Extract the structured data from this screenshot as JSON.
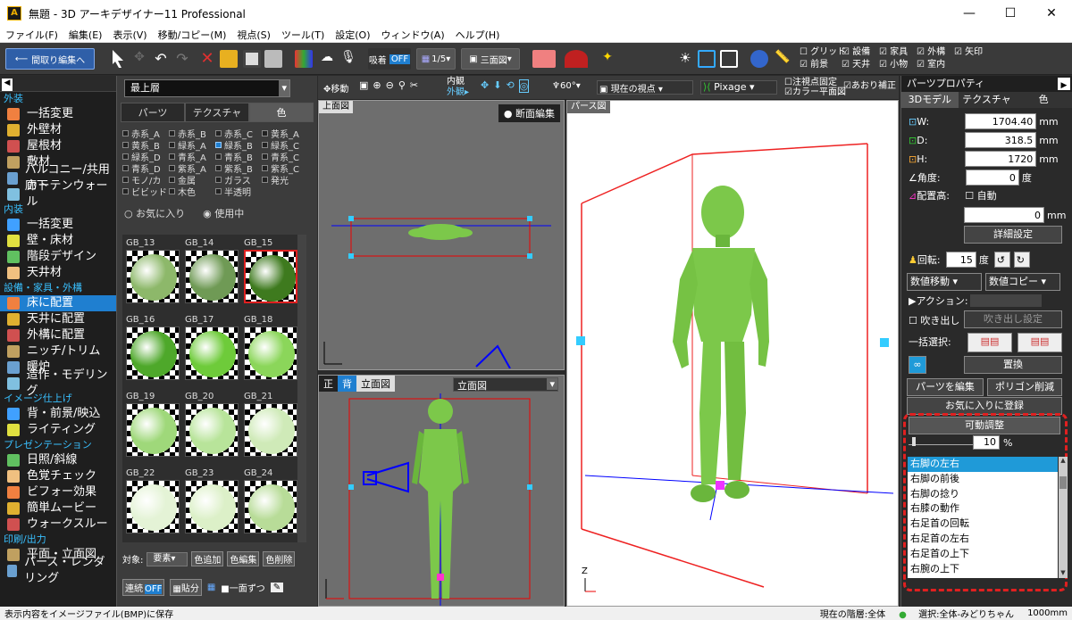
{
  "app": {
    "title": "無題 - 3D アーキデザイナー11 Professional",
    "icon": "app-logo-icon"
  },
  "window_controls": {
    "minimize": "—",
    "maximize": "☐",
    "close": "✕"
  },
  "menu": [
    "ファイル(F)",
    "編集(E)",
    "表示(V)",
    "移動/コピー(M)",
    "視点(S)",
    "ツール(T)",
    "設定(O)",
    "ウィンドウ(A)",
    "ヘルプ(H)"
  ],
  "toolbar": {
    "back_button": "間取り編集へ",
    "snap_label": "吸着",
    "snap_state": "OFF",
    "scale": "1/5",
    "view_mode": "三面図",
    "grid": "グリッド",
    "front": "前景",
    "equip": "設備",
    "ceiling": "天井",
    "furniture": "家具",
    "small": "小物",
    "exterior": "外構",
    "indoor": "室内",
    "arrow": "矢印"
  },
  "left": {
    "sections": [
      {
        "title": "外装",
        "items": [
          "一括変更",
          "外壁材",
          "屋根材",
          "敷材",
          "バルコニー/共用廊下",
          "カーテンウォール"
        ]
      },
      {
        "title": "内装",
        "items": [
          "一括変更",
          "壁・床材",
          "階段デザイン",
          "天井材"
        ]
      },
      {
        "title": "設備・家具・外構",
        "items": [
          "床に配置",
          "天井に配置",
          "外構に配置",
          "ニッチ/トリム",
          "暖炉",
          "造作・モデリング"
        ]
      },
      {
        "title": "イメージ仕上げ",
        "items": [
          "背・前景/映込",
          "ライティング"
        ]
      },
      {
        "title": "プレゼンテーション",
        "items": [
          "日照/斜線",
          "色覚チェック",
          "ビフォー効果",
          "簡単ムービー",
          "ウォークスルー"
        ]
      },
      {
        "title": "印刷/出力",
        "items": [
          "平面・立面図",
          "パース・レンダリング"
        ]
      }
    ],
    "selected": "床に配置"
  },
  "mid": {
    "floor": "最上層",
    "tabs": [
      "パーツ",
      "テクスチャ",
      "色"
    ],
    "active_tab": "色",
    "color_groups": [
      "赤系_A",
      "赤系_B",
      "赤系_C",
      "黄系_A",
      "黄系_B",
      "緑系_A",
      "緑系_B",
      "緑系_C",
      "緑系_D",
      "青系_A",
      "青系_B",
      "青系_C",
      "青系_D",
      "紫系_A",
      "紫系_B",
      "紫系_C",
      "モノ/カ",
      "金属",
      "ガラス",
      "発光",
      "ビビッド",
      "木色",
      "半透明"
    ],
    "checked_group": "緑系_B",
    "radio_fav": "お気に入り",
    "radio_used": "使用中",
    "swatches": [
      {
        "name": "GB_13",
        "color": "#8db86a"
      },
      {
        "name": "GB_14",
        "color": "#6f9a55"
      },
      {
        "name": "GB_15",
        "color": "#3e7a1e"
      },
      {
        "name": "GB_16",
        "color": "#4ea82a"
      },
      {
        "name": "GB_17",
        "color": "#6ecb3a"
      },
      {
        "name": "GB_18",
        "color": "#8bd65a"
      },
      {
        "name": "GB_19",
        "color": "#9fd87a"
      },
      {
        "name": "GB_20",
        "color": "#b8e49a"
      },
      {
        "name": "GB_21",
        "color": "#cfeab8"
      },
      {
        "name": "GB_22",
        "color": "#e4f3d6"
      },
      {
        "name": "GB_23",
        "color": "#dcf0c8"
      },
      {
        "name": "GB_24",
        "color": "#b8dc98"
      }
    ],
    "selected_swatch": "GB_15",
    "target_label": "対象:",
    "target_value": "要素",
    "add_color": "色追加",
    "edit_color": "色編集",
    "del_color": "色削除",
    "continuous": "連続",
    "continuous_state": "OFF",
    "paste": "貼分",
    "one_side": "一面ずつ"
  },
  "viewport": {
    "toolbar": {
      "move": "移動",
      "inner": "内観",
      "outer": "外観▸",
      "fov": "60°",
      "viewpoint": "現在の視点",
      "pixage": "Pixage",
      "note_fix": "注視点固定",
      "tilt": "あおり補正",
      "color_plan": "カラー平面図"
    },
    "top_label": "上面図",
    "section_edit": "断面編集",
    "persp_label": "パース図",
    "front_btn": "正",
    "back_btn": "背",
    "elev_label": "立面図",
    "elev_dd": "立面図"
  },
  "right": {
    "title": "パーツプロパティ",
    "tabs": [
      "3Dモデル",
      "テクスチャ",
      "色"
    ],
    "w_label": "W:",
    "w": "1704.40",
    "d_label": "D:",
    "d": "318.5",
    "h_label": "H:",
    "h": "1720",
    "unit": "mm",
    "angle_label": "角度:",
    "angle": "0",
    "deg": "度",
    "height_label": "配置高:",
    "auto": "自動",
    "height": "0",
    "detail_btn": "詳細設定",
    "rot_label": "回転:",
    "rot": "15",
    "move_dd": "数値移動",
    "copy_dd": "数値コピー",
    "action_label": "アクション:",
    "bubble": "吹き出し",
    "bubble_set": "吹き出し設定",
    "bulk_select": "一括選択:",
    "replace": "置換",
    "edit_parts": "パーツを編集",
    "poly_reduce": "ポリゴン削減",
    "fav_register": "お気に入りに登録",
    "movable": "可動調整",
    "percent": "10",
    "pct_unit": "%",
    "joints": [
      "右脚の左右",
      "右脚の前後",
      "右脚の捻り",
      "右膝の動作",
      "右足首の回転",
      "右足首の左右",
      "右足首の上下",
      "右腕の上下"
    ],
    "selected_joint": "右脚の左右"
  },
  "status": {
    "left": "表示内容をイメージファイル(BMP)に保存",
    "layer": "現在の階層:全体",
    "selection": "選択:全体-みどりちゃん",
    "scale": "1000mm"
  },
  "colors": {
    "accent": "#1f7fd0",
    "section": "#39c0ff",
    "figure": "#7cc84a",
    "highlight": "#e02020"
  }
}
